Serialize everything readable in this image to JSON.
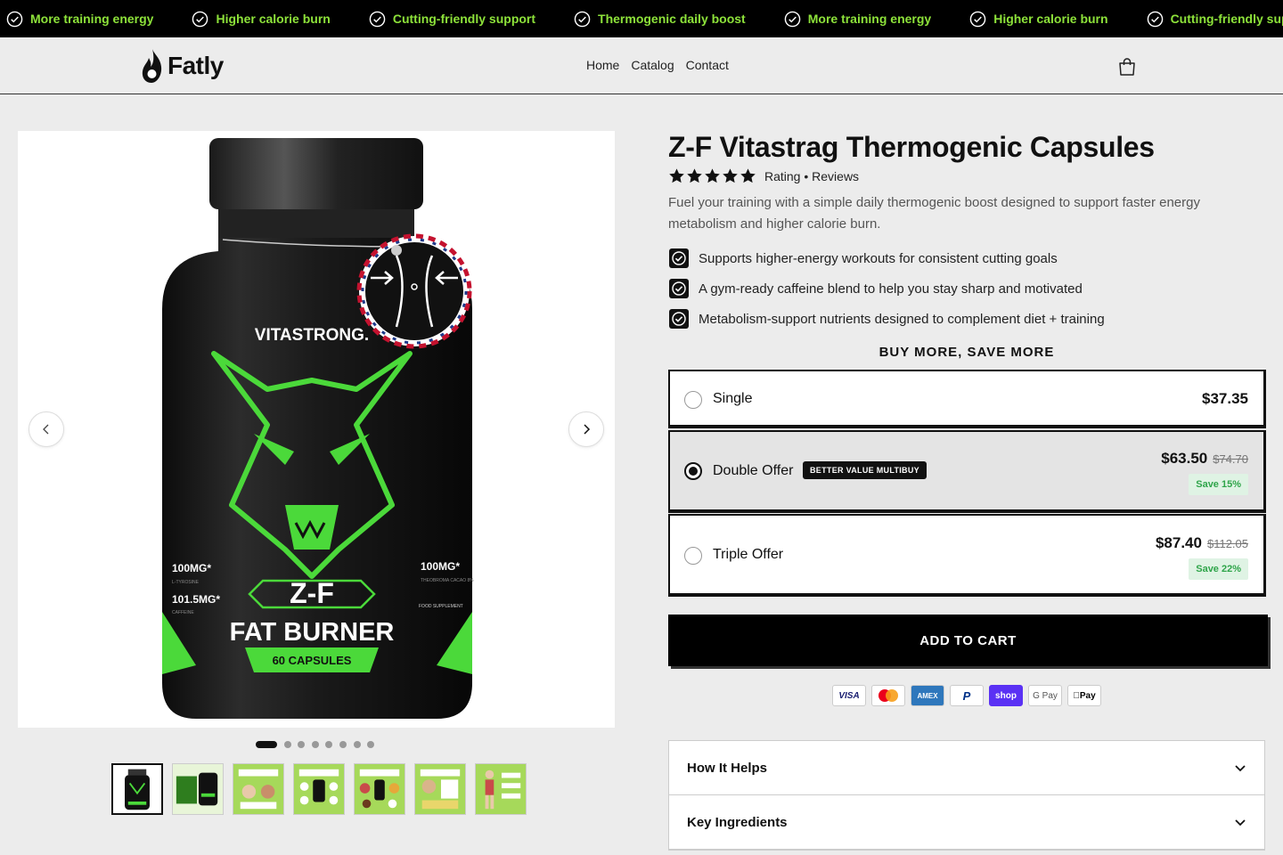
{
  "ticker": {
    "items": [
      "More training energy",
      "Higher calorie burn",
      "Cutting-friendly support",
      "Thermogenic daily boost",
      "More training energy",
      "Higher calorie burn",
      "Cutting-friendly support"
    ],
    "text_color": "#8de23a"
  },
  "header": {
    "logo_text": "Fatly",
    "nav": [
      "Home",
      "Catalog",
      "Contact"
    ],
    "cart_icon": "shopping-bag-icon"
  },
  "gallery": {
    "main_image_alt": "Z-F Fat Burner 60 capsules bottle",
    "bottle": {
      "brand": "VITASTRONG.",
      "product": "Z-F",
      "subtitle": "FAT BURNER",
      "capsules": "60 CAPSULES",
      "left_stat_1": "100MG*",
      "left_stat_1_sub": "L-TYROSINE",
      "left_stat_2": "101.5MG*",
      "left_stat_2_sub": "CAFFEINE",
      "right_stat": "100MG*",
      "right_stat_sub": "THEOBROMA CACAO 8%",
      "right_note": "FOOD SUPPLEMENT"
    },
    "dots_count": 9,
    "active_dot": 0,
    "thumbnail_count": 7,
    "active_thumbnail": 0
  },
  "product": {
    "title": "Z-F Vitastrag Thermogenic Capsules",
    "stars": 5,
    "rating_text": "Rating • Reviews",
    "description": "Fuel your training with a simple daily thermogenic boost designed to support faster energy metabolism and higher calorie burn.",
    "benefits": [
      "Supports higher-energy workouts for consistent cutting goals",
      "A gym-ready caffeine blend to help you stay sharp and motivated",
      "Metabolism-support nutrients designed to complement diet + training"
    ],
    "buy_more_heading": "BUY MORE, SAVE MORE",
    "offers": [
      {
        "label": "Single",
        "price": "$37.35",
        "selected": false
      },
      {
        "label": "Double Offer",
        "badge": "BETTER VALUE MULTIBUY",
        "price": "$63.50",
        "compare_price": "$74.70",
        "save": "Save 15%",
        "selected": true
      },
      {
        "label": "Triple Offer",
        "price": "$87.40",
        "compare_price": "$112.05",
        "save": "Save 22%",
        "selected": false
      }
    ],
    "add_to_cart": "ADD TO CART",
    "payment_methods": [
      "VISA",
      "Mastercard",
      "AMEX",
      "PayPal",
      "shop",
      "G Pay",
      "Apple Pay"
    ],
    "accordion": [
      "How It Helps",
      "Key Ingredients"
    ]
  },
  "colors": {
    "accent_green": "#8de23a",
    "save_green": "#2fa54a",
    "black": "#000000"
  }
}
